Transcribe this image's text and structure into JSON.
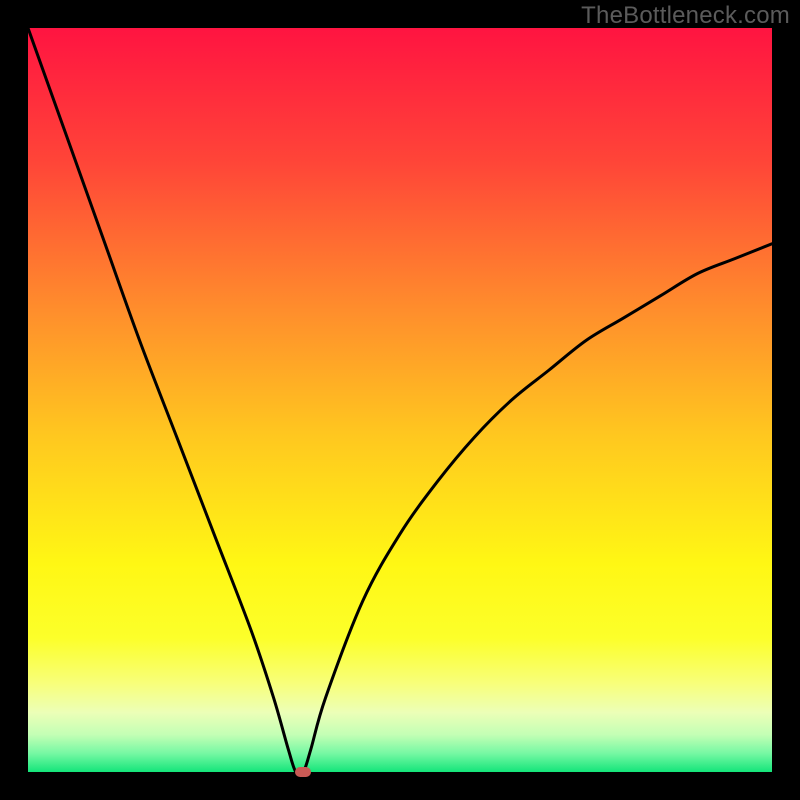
{
  "watermark": {
    "text": "TheBottleneck.com"
  },
  "chart_data": {
    "type": "line",
    "title": "",
    "xlabel": "",
    "ylabel": "",
    "xlim": [
      0,
      100
    ],
    "ylim": [
      0,
      100
    ],
    "grid": false,
    "marker": {
      "x": 37,
      "y": 0,
      "color": "#c95a55"
    },
    "curve": [
      {
        "x": 0,
        "y": 100
      },
      {
        "x": 5,
        "y": 86
      },
      {
        "x": 10,
        "y": 72
      },
      {
        "x": 15,
        "y": 58
      },
      {
        "x": 20,
        "y": 45
      },
      {
        "x": 25,
        "y": 32
      },
      {
        "x": 30,
        "y": 19
      },
      {
        "x": 33,
        "y": 10
      },
      {
        "x": 35,
        "y": 3
      },
      {
        "x": 36,
        "y": 0
      },
      {
        "x": 37,
        "y": 0
      },
      {
        "x": 38,
        "y": 3
      },
      {
        "x": 40,
        "y": 10
      },
      {
        "x": 45,
        "y": 23
      },
      {
        "x": 50,
        "y": 32
      },
      {
        "x": 55,
        "y": 39
      },
      {
        "x": 60,
        "y": 45
      },
      {
        "x": 65,
        "y": 50
      },
      {
        "x": 70,
        "y": 54
      },
      {
        "x": 75,
        "y": 58
      },
      {
        "x": 80,
        "y": 61
      },
      {
        "x": 85,
        "y": 64
      },
      {
        "x": 90,
        "y": 67
      },
      {
        "x": 95,
        "y": 69
      },
      {
        "x": 100,
        "y": 71
      }
    ],
    "gradient_stops": [
      {
        "pos": 0.0,
        "color": "#ff1441"
      },
      {
        "pos": 0.18,
        "color": "#ff4538"
      },
      {
        "pos": 0.38,
        "color": "#ff8e2c"
      },
      {
        "pos": 0.55,
        "color": "#ffc81f"
      },
      {
        "pos": 0.72,
        "color": "#fff714"
      },
      {
        "pos": 0.82,
        "color": "#fcff2a"
      },
      {
        "pos": 0.88,
        "color": "#f8ff79"
      },
      {
        "pos": 0.92,
        "color": "#ecffb7"
      },
      {
        "pos": 0.95,
        "color": "#c3ffb5"
      },
      {
        "pos": 0.975,
        "color": "#76f8a3"
      },
      {
        "pos": 1.0,
        "color": "#14e57a"
      }
    ]
  }
}
